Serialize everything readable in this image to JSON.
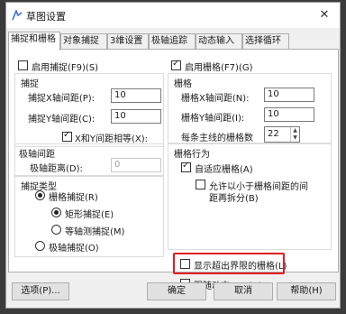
{
  "window": {
    "title": "草图设置"
  },
  "tabs": [
    "捕捉和栅格",
    "对象捕捉",
    "3维设置",
    "极轴追踪",
    "动态输入",
    "选择循环"
  ],
  "snap": {
    "enable_label": "启用捕捉(F9)(S)",
    "group_title": "捕捉",
    "x_label": "捕捉X轴间距(P):",
    "x_value": "10",
    "y_label": "捕捉Y轴间距(C):",
    "y_value": "10",
    "equal_label": "X和Y间距相等(X):"
  },
  "polar": {
    "group_title": "极轴间距",
    "distance_label": "极轴距离(D):",
    "distance_value": "0"
  },
  "snap_type": {
    "group_title": "捕捉类型",
    "grid_snap": "栅格捕捉(R)",
    "rect_snap": "矩形捕捉(E)",
    "iso_snap": "等轴测捕捉(M)",
    "polar_snap": "极轴捕捉(O)"
  },
  "grid": {
    "enable_label": "启用栅格(F7)(G)",
    "group_title": "栅格",
    "x_label": "栅格X轴间距(N):",
    "x_value": "10",
    "y_label": "栅格Y轴间距(I):",
    "y_value": "10",
    "major_label": "每条主线的栅格数",
    "major_value": "22"
  },
  "grid_behavior": {
    "group_title": "栅格行为",
    "adaptive": "自适应栅格(A)",
    "subdivide_line1": "允许以小于栅格间距的间",
    "subdivide_line2": "距再拆分(B)",
    "beyond_limits": "显示超出界限的栅格(L)",
    "follow_ucs": "跟随动态UCS(U)"
  },
  "buttons": {
    "options": "选项(P)...",
    "ok": "确定",
    "cancel": "取消",
    "help": "帮助(H)"
  },
  "colors": {
    "highlight": "#e11e1e",
    "app_icon": "#3a6fd8"
  }
}
